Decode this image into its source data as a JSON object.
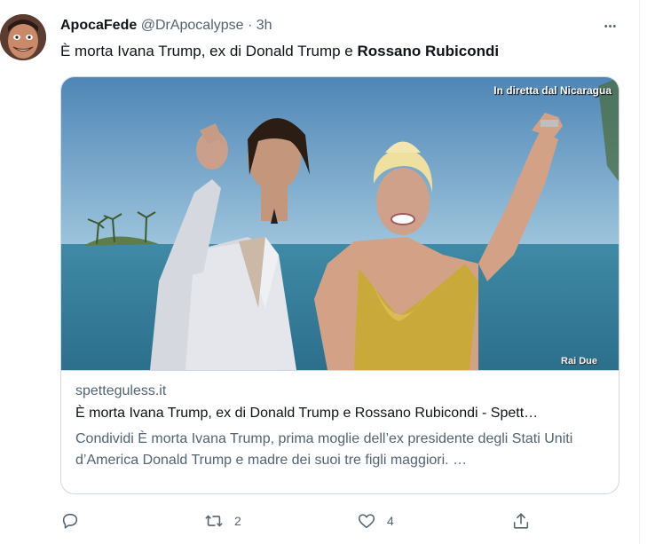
{
  "tweet": {
    "author_name": "ApocaFede",
    "author_handle": "@DrApocalypse",
    "time_separator": "·",
    "time": "3h",
    "more_label": "•••",
    "text": "È morta Ivana Trump, ex di Donald Trump e ",
    "text_bold": "Rossano Rubicondi"
  },
  "card": {
    "image_overlay_text": "In diretta dal Nicaragua",
    "image_logo_text": "Rai  Due",
    "domain": "spetteguless.it",
    "title": "È morta Ivana Trump, ex di Donald Trump e Rossano Rubicondi - Spett…",
    "description": "Condividi È morta Ivana Trump, prima moglie dell’ex presidente degli Stati Uniti d’America Donald Trump e madre dei suoi tre figli maggiori. …"
  },
  "actions": {
    "reply_icon": "reply-icon",
    "retweet_icon": "retweet-icon",
    "retweet_count": "2",
    "like_icon": "heart-icon",
    "like_count": "4",
    "share_icon": "share-icon"
  },
  "colors": {
    "text_primary": "#0f1419",
    "text_secondary": "#536471",
    "border": "#cfd9de"
  }
}
